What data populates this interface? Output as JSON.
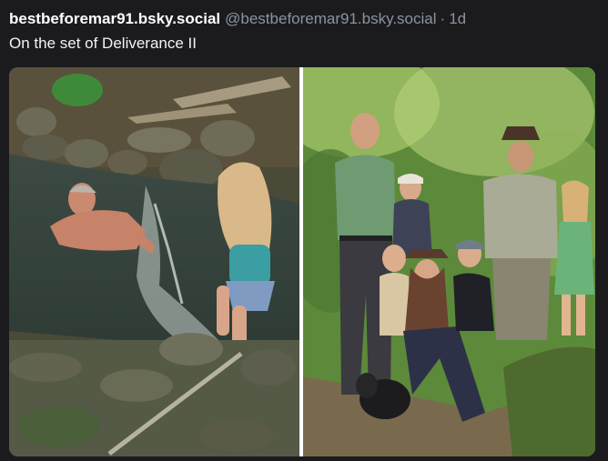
{
  "post": {
    "display_name": "bestbeforemar91.bsky.social",
    "handle": "@bestbeforemar91.bsky.social",
    "separator": "·",
    "timestamp": "1d",
    "text": "On the set of Deliverance II"
  },
  "media": {
    "images": [
      {
        "kind": "photo",
        "subject": "creek-bathing-scene"
      },
      {
        "kind": "photo",
        "subject": "family-group-forest-scene"
      }
    ]
  }
}
